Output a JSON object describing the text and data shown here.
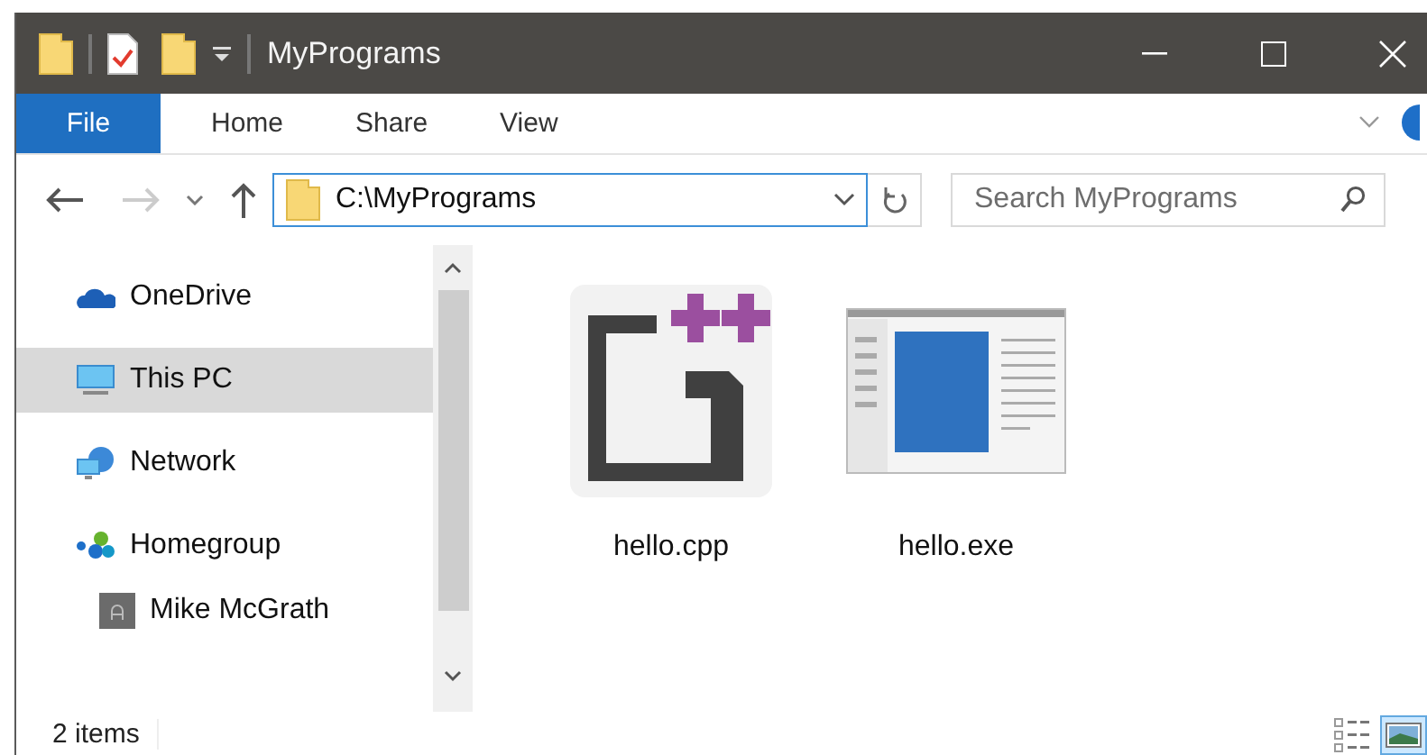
{
  "window": {
    "title": "MyPrograms"
  },
  "ribbon_tabs": [
    {
      "label": "File",
      "kind": "file"
    },
    {
      "label": "Home",
      "kind": "tab"
    },
    {
      "label": "Share",
      "kind": "tab"
    },
    {
      "label": "View",
      "kind": "tab"
    }
  ],
  "address": {
    "path": "C:\\MyPrograms"
  },
  "search": {
    "placeholder": "Search MyPrograms"
  },
  "nav": {
    "items": [
      {
        "label": "OneDrive",
        "kind": "onedrive",
        "selected": false
      },
      {
        "label": "This PC",
        "kind": "pc",
        "selected": true
      },
      {
        "label": "Network",
        "kind": "network",
        "selected": false
      },
      {
        "label": "Homegroup",
        "kind": "homegroup",
        "selected": false,
        "children": [
          {
            "label": "Mike McGrath",
            "kind": "user",
            "selected": false
          }
        ]
      }
    ]
  },
  "files": [
    {
      "name": "hello.cpp",
      "kind": "cpp"
    },
    {
      "name": "hello.exe",
      "kind": "exe"
    }
  ],
  "status_bar": {
    "item_count": "2 items",
    "views": [
      {
        "kind": "details",
        "selected": false
      },
      {
        "kind": "large-icons",
        "selected": true
      }
    ]
  }
}
